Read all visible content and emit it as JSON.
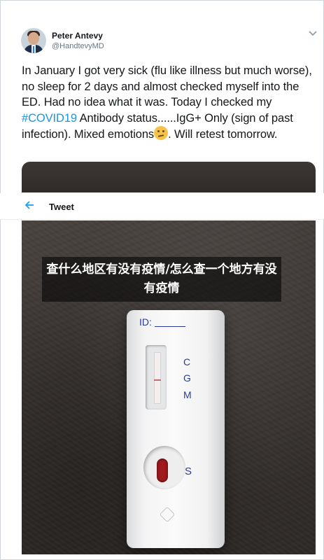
{
  "tweet": {
    "author_name": "Peter Antevy",
    "author_handle": "@HandtevyMD",
    "text_1": "In January I got very sick (flu like illness but much worse), no sleep for 2 days and almost checked myself into the ED.  Had no idea what it was.  Today I checked my ",
    "hashtag": "#COVID19",
    "text_2": " Antibody status......IgG+ Only (sign of past infection).  Mixed emotions",
    "text_3": ".  Will retest tomorrow.",
    "emoji_icon": "thinking-face-icon"
  },
  "tweet_header": {
    "title": "Tweet",
    "back_icon": "arrow-left-icon"
  },
  "test_kit": {
    "id_label": "ID:",
    "c_label": "C",
    "g_label": "G",
    "m_label": "M",
    "s_label": "S"
  },
  "overlay": {
    "title": "查什么地区有没有疫情/怎么查一个地方有没有疫情"
  },
  "colors": {
    "hashtag": "#1b95e0",
    "kit_print": "#2a3c8f",
    "overlay_bg": "rgba(0,0,0,0.55)"
  }
}
